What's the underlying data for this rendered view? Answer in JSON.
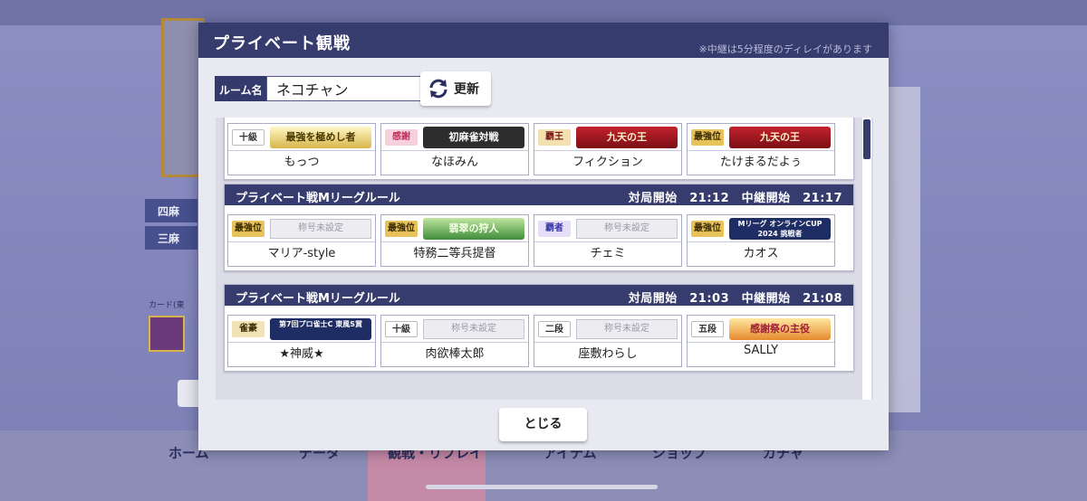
{
  "modal": {
    "title": "プライベート観戦",
    "delay_note": "※中継は5分程度のディレイがあります",
    "room_label": "ルーム名",
    "room_value": "ネコチャン",
    "refresh_label": "更新",
    "close_label": "とじる"
  },
  "colors": {
    "header": "#373c6e",
    "accent_gold": "#d8b54c",
    "accent_red": "#a8202c"
  },
  "matches": [
    {
      "rule": "",
      "times": "",
      "players": [
        {
          "name": "もっつ",
          "rank": "十級",
          "title": "最強を極めし者",
          "title_set": true
        },
        {
          "name": "なほみん",
          "rank": "感謝",
          "title": "初麻雀対戦",
          "title_set": true
        },
        {
          "name": "フィクション",
          "rank": "覇王",
          "title": "九天の王",
          "title_set": true
        },
        {
          "name": "たけまるだよぅ",
          "rank": "最強位",
          "title": "九天の王",
          "title_set": true
        }
      ]
    },
    {
      "rule": "プライベート戦Mリーグルール",
      "times": "対局開始　21:12　中継開始　21:17",
      "players": [
        {
          "name": "マリア-style",
          "rank": "最強位",
          "title": "称号未設定",
          "title_set": false
        },
        {
          "name": "特務二等兵提督",
          "rank": "最強位",
          "title": "翡翠の狩人",
          "title_set": true
        },
        {
          "name": "チェミ",
          "rank": "覇者",
          "title": "称号未設定",
          "title_set": false
        },
        {
          "name": "カオス",
          "rank": "最強位",
          "title": "Mリーグ オンラインCUP 2024 挑戦者",
          "title_set": true
        }
      ]
    },
    {
      "rule": "プライベート戦Mリーグルール",
      "times": "対局開始　21:03　中継開始　21:08",
      "players": [
        {
          "name": "★神威★",
          "rank": "雀豪",
          "title": "第7回プロ雀士C 東風S賞",
          "title_set": true
        },
        {
          "name": "肉欲棒太郎",
          "rank": "十級",
          "title": "称号未設定",
          "title_set": false
        },
        {
          "name": "座敷わらし",
          "rank": "二段",
          "title": "称号未設定",
          "title_set": false
        },
        {
          "name": "SALLY",
          "rank": "五段",
          "title": "感謝祭の主役",
          "title_set": true
        }
      ]
    }
  ],
  "background": {
    "badges": [
      "四麻",
      "三麻"
    ],
    "card_label": "カード(東",
    "nav": [
      "ホーム",
      "データ",
      "観戦・リプレイ",
      "アイテム",
      "ショップ",
      "ガチャ"
    ]
  }
}
